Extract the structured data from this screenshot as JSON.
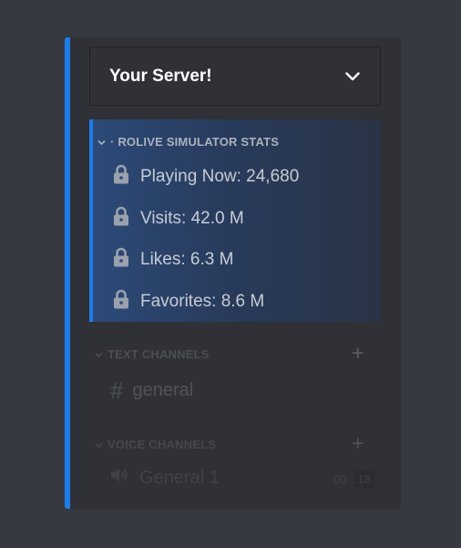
{
  "server": {
    "name": "Your Server!",
    "menu_icon": "chevron-down-icon"
  },
  "stats_category": {
    "label": "· ROLIVE SIMULATOR STATS",
    "channels": [
      {
        "label": "Playing Now: 24,680",
        "icon": "lock-icon"
      },
      {
        "label": "Visits: 42.0 M",
        "icon": "lock-icon"
      },
      {
        "label": "Likes: 6.3 M",
        "icon": "lock-icon"
      },
      {
        "label": "Favorites: 8.6 M",
        "icon": "lock-icon"
      }
    ]
  },
  "text_category": {
    "label": "TEXT CHANNELS",
    "add_symbol": "+",
    "channels": [
      {
        "symbol": "#",
        "label": "general"
      }
    ]
  },
  "voice_category": {
    "label": "VOICE CHANNELS",
    "add_symbol": "+",
    "channels": [
      {
        "label": "General 1",
        "time_a": "00",
        "time_b": "18"
      }
    ]
  },
  "colors": {
    "accent": "#1e7ce8",
    "background": "#36393f",
    "panel": "#2f3136"
  }
}
